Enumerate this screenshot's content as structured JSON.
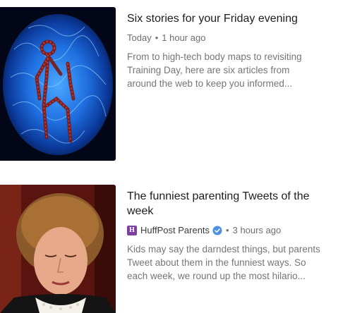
{
  "stories": [
    {
      "title": "Six stories for your Friday evening",
      "timestamp": "Today",
      "age": "1 hour ago",
      "summary_lines": [
        "From to high-tech body maps to revisiting",
        "Training Day, here are six articles from",
        "around the web to keep you informed..."
      ],
      "thumbnail": "blue-cell-body-map-image"
    },
    {
      "title_lines": [
        "The funniest parenting Tweets of the",
        "week"
      ],
      "source_icon_letter": "H",
      "source": "HuffPost Parents",
      "age": "3 hours ago",
      "summary_lines": [
        "Kids may say the darndest things, but parents",
        "Tweet about them in the funniest ways. So",
        "each week, we round up the most hilario..."
      ],
      "thumbnail": "judge-portrait-image"
    }
  ],
  "separator": "•",
  "colors": {
    "source_badge": "#7b3f9e",
    "verified": "#4a90e2"
  }
}
